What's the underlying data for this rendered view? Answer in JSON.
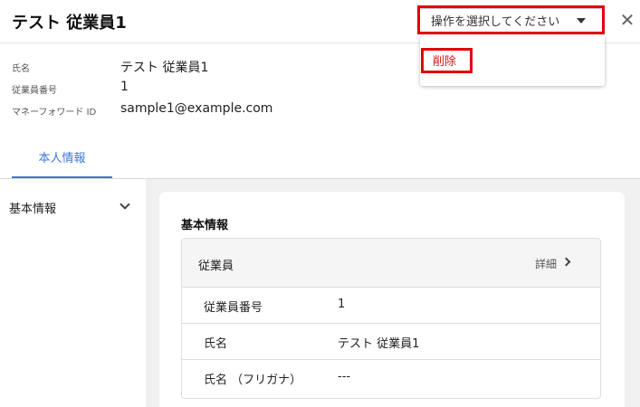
{
  "header": {
    "title": "テスト 従業員1",
    "action_select_label": "操作を選択してください",
    "close_glyph": "✕"
  },
  "dropdown": {
    "items": [
      {
        "label": "削除",
        "color": "#d4151a"
      }
    ]
  },
  "summary": [
    {
      "label": "氏名",
      "value": "テスト 従業員1"
    },
    {
      "label": "従業員番号",
      "value": "1"
    },
    {
      "label": "マネーフォワード ID",
      "value": "sample1@example.com"
    }
  ],
  "tabs": [
    {
      "label": "本人情報",
      "active": true
    }
  ],
  "sidenav": {
    "items": [
      {
        "label": "基本情報"
      }
    ]
  },
  "main": {
    "section_title": "基本情報",
    "box": {
      "title": "従業員",
      "detail_label": "詳細",
      "rows": [
        {
          "label": "従業員番号",
          "value": "1"
        },
        {
          "label": "氏名",
          "value": "テスト 従業員1"
        },
        {
          "label": "氏名 （フリガナ）",
          "value": "---"
        }
      ]
    }
  },
  "colors": {
    "accent": "#3b78d8",
    "highlight": "#e0000c",
    "danger": "#d4151a"
  }
}
